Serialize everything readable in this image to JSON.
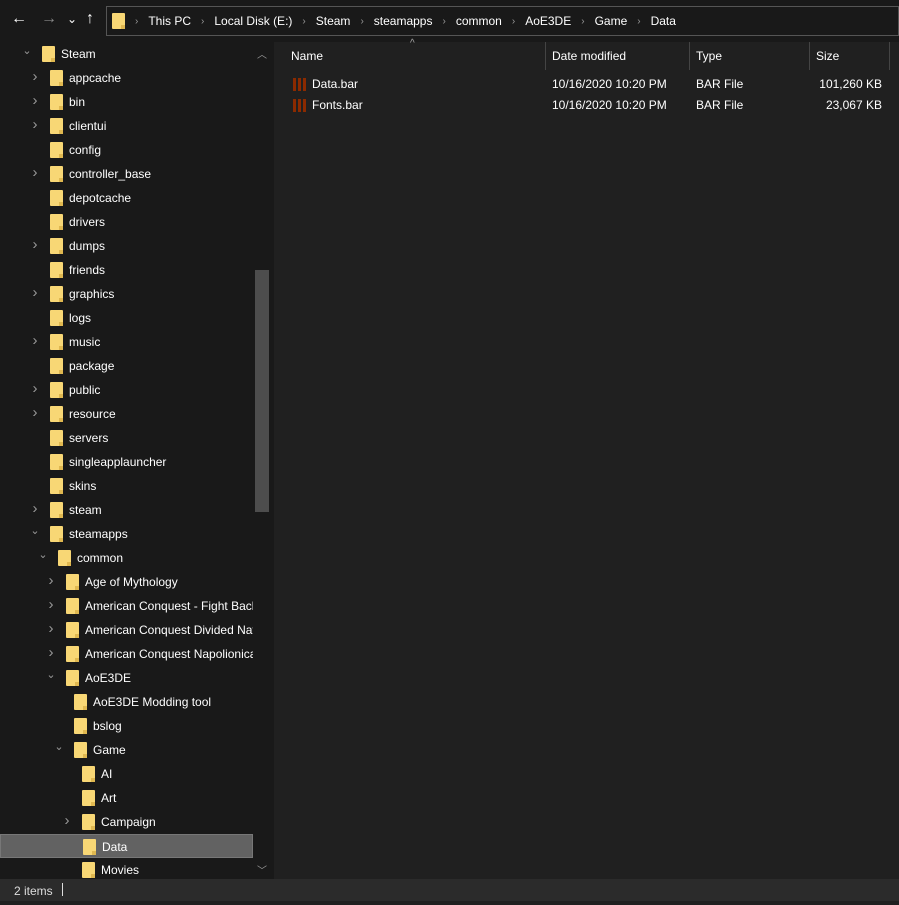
{
  "toolbar": {
    "back": "←",
    "forward": "→",
    "recent": "⌄",
    "up": "↑"
  },
  "breadcrumb": [
    "This PC",
    "Local Disk (E:)",
    "Steam",
    "steamapps",
    "common",
    "AoE3DE",
    "Game",
    "Data"
  ],
  "tree": [
    {
      "label": "Steam",
      "level": 0,
      "chevron": "down"
    },
    {
      "label": "appcache",
      "level": 1,
      "chevron": "right"
    },
    {
      "label": "bin",
      "level": 1,
      "chevron": "right"
    },
    {
      "label": "clientui",
      "level": 1,
      "chevron": "right"
    },
    {
      "label": "config",
      "level": 1,
      "chevron": "none"
    },
    {
      "label": "controller_base",
      "level": 1,
      "chevron": "right"
    },
    {
      "label": "depotcache",
      "level": 1,
      "chevron": "none"
    },
    {
      "label": "drivers",
      "level": 1,
      "chevron": "none"
    },
    {
      "label": "dumps",
      "level": 1,
      "chevron": "right"
    },
    {
      "label": "friends",
      "level": 1,
      "chevron": "none"
    },
    {
      "label": "graphics",
      "level": 1,
      "chevron": "right"
    },
    {
      "label": "logs",
      "level": 1,
      "chevron": "none"
    },
    {
      "label": "music",
      "level": 1,
      "chevron": "right"
    },
    {
      "label": "package",
      "level": 1,
      "chevron": "none"
    },
    {
      "label": "public",
      "level": 1,
      "chevron": "right"
    },
    {
      "label": "resource",
      "level": 1,
      "chevron": "right"
    },
    {
      "label": "servers",
      "level": 1,
      "chevron": "none"
    },
    {
      "label": "singleapplauncher",
      "level": 1,
      "chevron": "none"
    },
    {
      "label": "skins",
      "level": 1,
      "chevron": "none"
    },
    {
      "label": "steam",
      "level": 1,
      "chevron": "right"
    },
    {
      "label": "steamapps",
      "level": 1,
      "chevron": "down"
    },
    {
      "label": "common",
      "level": 2,
      "chevron": "down"
    },
    {
      "label": "Age of Mythology",
      "level": 3,
      "chevron": "right"
    },
    {
      "label": "American Conquest - Fight Back",
      "level": 3,
      "chevron": "right"
    },
    {
      "label": "American Conquest Divided Nat",
      "level": 3,
      "chevron": "right"
    },
    {
      "label": "American Conquest Napolionica",
      "level": 3,
      "chevron": "right"
    },
    {
      "label": "AoE3DE",
      "level": 3,
      "chevron": "down"
    },
    {
      "label": "AoE3DE Modding tool",
      "level": 4,
      "chevron": "none"
    },
    {
      "label": "bslog",
      "level": 4,
      "chevron": "none"
    },
    {
      "label": "Game",
      "level": 4,
      "chevron": "down"
    },
    {
      "label": "AI",
      "level": 5,
      "chevron": "none"
    },
    {
      "label": "Art",
      "level": 5,
      "chevron": "none"
    },
    {
      "label": "Campaign",
      "level": 5,
      "chevron": "right"
    },
    {
      "label": "Data",
      "level": 5,
      "chevron": "none",
      "selected": true
    },
    {
      "label": "Movies",
      "level": 5,
      "chevron": "none"
    }
  ],
  "columns": {
    "name": "Name",
    "date": "Date modified",
    "type": "Type",
    "size": "Size"
  },
  "files": [
    {
      "name": "Data.bar",
      "date": "10/16/2020 10:20 PM",
      "type": "BAR File",
      "size": "101,260 KB"
    },
    {
      "name": "Fonts.bar",
      "date": "10/16/2020 10:20 PM",
      "type": "BAR File",
      "size": "23,067 KB"
    }
  ],
  "status": {
    "items": "2 items"
  }
}
